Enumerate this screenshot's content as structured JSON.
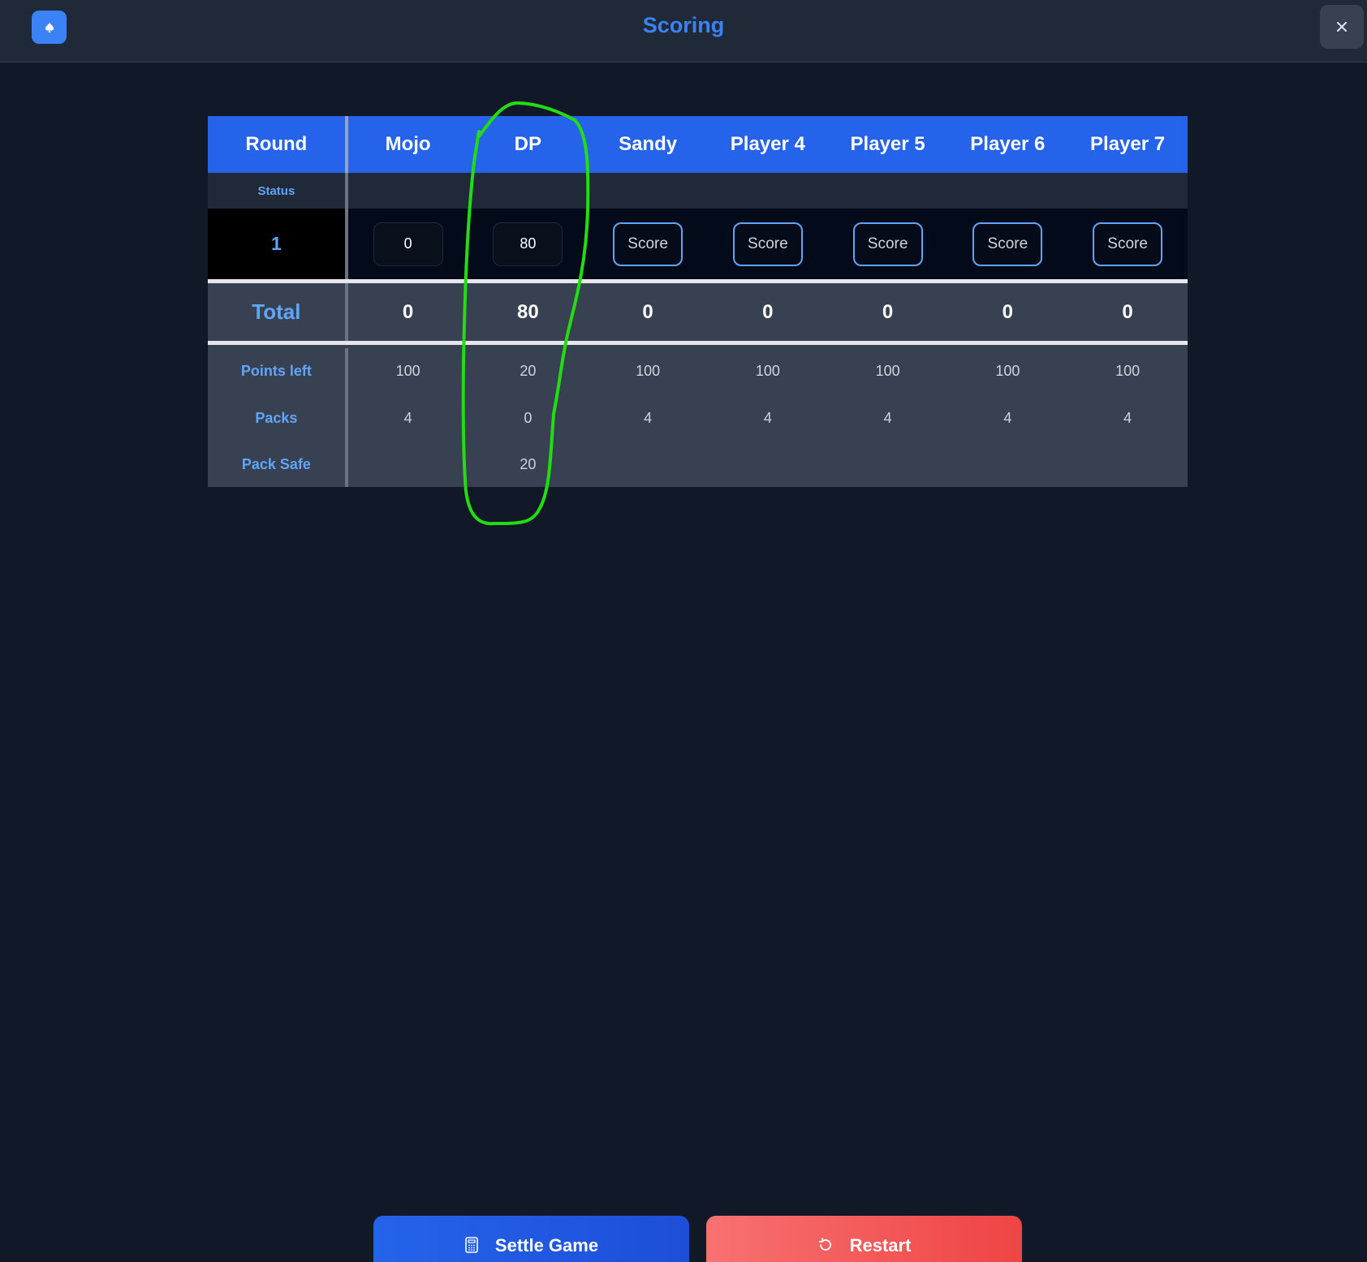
{
  "header": {
    "title": "Scoring",
    "logo_icon": "spade-icon",
    "close_icon": "close-icon"
  },
  "table": {
    "round_header": "Round",
    "players": [
      "Mojo",
      "DP",
      "Sandy",
      "Player 4",
      "Player 5",
      "Player 6",
      "Player 7"
    ],
    "status_label": "Status",
    "rounds": [
      {
        "number": "1",
        "scores": [
          "0",
          "80",
          "Score",
          "Score",
          "Score",
          "Score",
          "Score"
        ]
      }
    ],
    "total_label": "Total",
    "totals": [
      "0",
      "80",
      "0",
      "0",
      "0",
      "0",
      "0"
    ],
    "points_left_label": "Points left",
    "points_left": [
      "100",
      "20",
      "100",
      "100",
      "100",
      "100",
      "100"
    ],
    "packs_label": "Packs",
    "packs": [
      "4",
      "0",
      "4",
      "4",
      "4",
      "4",
      "4"
    ],
    "pack_safe_label": "Pack Safe",
    "pack_safe": [
      "",
      "20",
      "",
      "",
      "",
      "",
      ""
    ]
  },
  "buttons": {
    "settle_label": "Settle Game",
    "settle_icon": "calculator-icon",
    "restart_label": "Restart",
    "restart_icon": "restart-icon"
  },
  "colors": {
    "background": "#111827",
    "accent": "#2563eb",
    "label": "#60a5fa",
    "danger": "#ef4444",
    "annotation": "#22dd11"
  }
}
